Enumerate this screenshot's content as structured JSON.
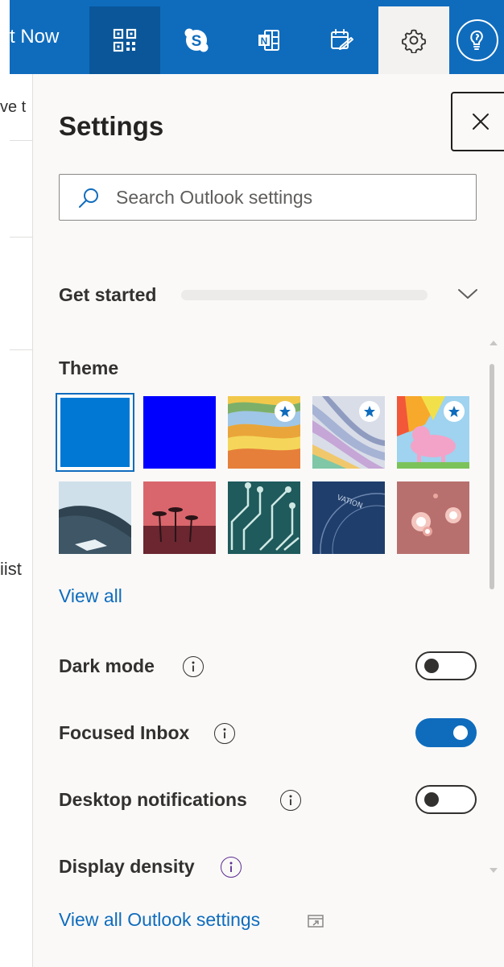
{
  "top_bar": {
    "partial_title": "t Now",
    "buttons": [
      {
        "icon": "qr-code-icon",
        "selected": true
      },
      {
        "icon": "skype-icon"
      },
      {
        "icon": "onenote-feed-icon"
      },
      {
        "icon": "my-day-icon"
      },
      {
        "icon": "gear-icon",
        "active": true
      },
      {
        "icon": "lightbulb-help-icon"
      }
    ]
  },
  "background_fragments": {
    "line1": "ve t",
    "line2": "iist"
  },
  "settings_panel": {
    "title": "Settings",
    "search_placeholder": "Search Outlook settings",
    "get_started": {
      "label": "Get started",
      "progress_fraction": 0.0
    },
    "theme": {
      "label": "Theme",
      "tiles": [
        {
          "name": "blue",
          "color": "#0078d4",
          "selected": true
        },
        {
          "name": "bright-blue",
          "color": "#0000ff"
        },
        {
          "name": "colorful-wave",
          "featured": true
        },
        {
          "name": "silver-ribbon",
          "featured": true
        },
        {
          "name": "unicorn",
          "featured": true
        },
        {
          "name": "mountain"
        },
        {
          "name": "palm-sunset"
        },
        {
          "name": "circuit"
        },
        {
          "name": "elevation"
        },
        {
          "name": "bokeh-lights"
        }
      ],
      "view_all": "View all"
    },
    "dark_mode": {
      "label": "Dark mode",
      "enabled": false
    },
    "focused_inbox": {
      "label": "Focused Inbox",
      "enabled": true
    },
    "desktop_notifications": {
      "label": "Desktop notifications",
      "enabled": false
    },
    "display_density": {
      "label": "Display density"
    },
    "view_all_outlook_settings": "View all Outlook settings"
  },
  "colors": {
    "accent": "#0f6cbd",
    "panel_background": "#faf9f8"
  }
}
